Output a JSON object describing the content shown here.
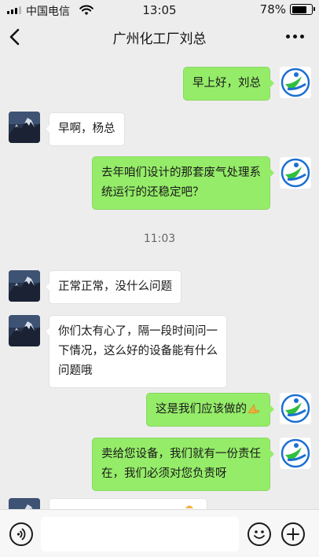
{
  "status_bar": {
    "carrier": "中国电信",
    "time": "13:05",
    "battery_percent": "78%",
    "battery_level": 0.78,
    "signal_bars_active": 3
  },
  "nav": {
    "title": "广州化工厂刘总",
    "back_icon": "chevron-left-icon",
    "more_icon": "more-dots-icon"
  },
  "messages": [
    {
      "from": "self",
      "text": "早上好，刘总"
    },
    {
      "from": "other",
      "text": "早啊，杨总"
    },
    {
      "from": "self",
      "text": "去年咱们设计的那套废气处理系\n统运行的还稳定吧？"
    },
    {
      "type": "time",
      "text": "11:03"
    },
    {
      "from": "other",
      "text": "正常正常，没什么问题"
    },
    {
      "from": "other",
      "text": "你们太有心了，隔一段时间问一\n下情况，这么好的设备能有什么\n问题哦"
    },
    {
      "from": "self",
      "text": "这是我们应该做的",
      "emoji": "folded-hands-emoji"
    },
    {
      "from": "self",
      "text": "卖给您设备，我们就有一份责任\n在，我们必须对您负责呀"
    }
  ],
  "input_bar": {
    "voice_icon": "voice-icon",
    "emoji_icon": "smiley-icon",
    "plus_icon": "plus-icon",
    "input_value": ""
  },
  "colors": {
    "background": "#ededed",
    "self_bubble": "#95ec69",
    "other_bubble": "#ffffff",
    "self_avatar_blue": "#1b6fd1",
    "self_avatar_green": "#2fbf3f"
  }
}
